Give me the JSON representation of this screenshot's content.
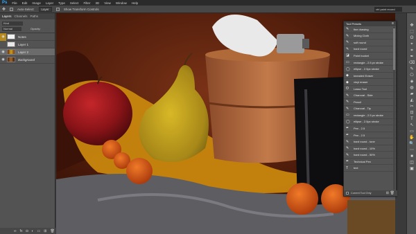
{
  "app": {
    "logo": "Ps"
  },
  "menu": [
    "File",
    "Edit",
    "Image",
    "Layer",
    "Type",
    "Select",
    "Filter",
    "3D",
    "View",
    "Window",
    "Help"
  ],
  "options": {
    "auto_select_label": "Auto-Select:",
    "auto_select_value": "Layer",
    "transform_label": "Show Transform Controls",
    "right_field": "ctrl paint record"
  },
  "layers_panel": {
    "tabs": [
      "Layers",
      "Channels",
      "Paths"
    ],
    "search_label": "Kind",
    "blend_mode": "Normal",
    "opacity_label": "Opacity:",
    "layers": [
      {
        "name": "Notes",
        "visible_highlight": true
      },
      {
        "name": "Layer 1",
        "visible_highlight": false
      },
      {
        "name": "Layer 2",
        "visible_highlight": false,
        "selected": true
      },
      {
        "name": "Background",
        "visible_highlight": false
      }
    ],
    "eye_icon": "◉",
    "bottom_icons": [
      "∞",
      "fx",
      "◘",
      "◐",
      "▭",
      "⊞",
      "🗑"
    ]
  },
  "presets_panel": {
    "title": "Tool Presets",
    "menu_icon": "≡",
    "items": [
      "fine drawing",
      "Mixing Cloth",
      "soft round",
      "hard round",
      "Paint bucket",
      "rectangle - 2.5 px stroke",
      "ellipse - 2.5px stroke",
      "kneaded Eraser",
      "vinyl eraser",
      "Lasso Tool",
      "Charcoal - Side",
      "Pencil",
      "Charcoal - Tip",
      "rectangle - 2.5 px stroke",
      "ellipse - 2.5px stroke",
      "Pen - 2.5",
      "Pen - 2.5",
      "hard round - tone",
      "hard round - 10%",
      "hard round - 50%",
      "Technical Pen",
      "text"
    ],
    "footer_label": "Current Tool Only"
  },
  "toolbar": [
    "✥",
    "⬚",
    "ʘ",
    "⌖",
    "⌗",
    "✒",
    "⌫",
    "✎",
    "⎔",
    "◈",
    "◍",
    "▰",
    "◭",
    "✂",
    "⊡",
    "T",
    "↖",
    "▭",
    "✋",
    "🔍",
    "⋯",
    "■",
    "◫",
    "▣"
  ]
}
